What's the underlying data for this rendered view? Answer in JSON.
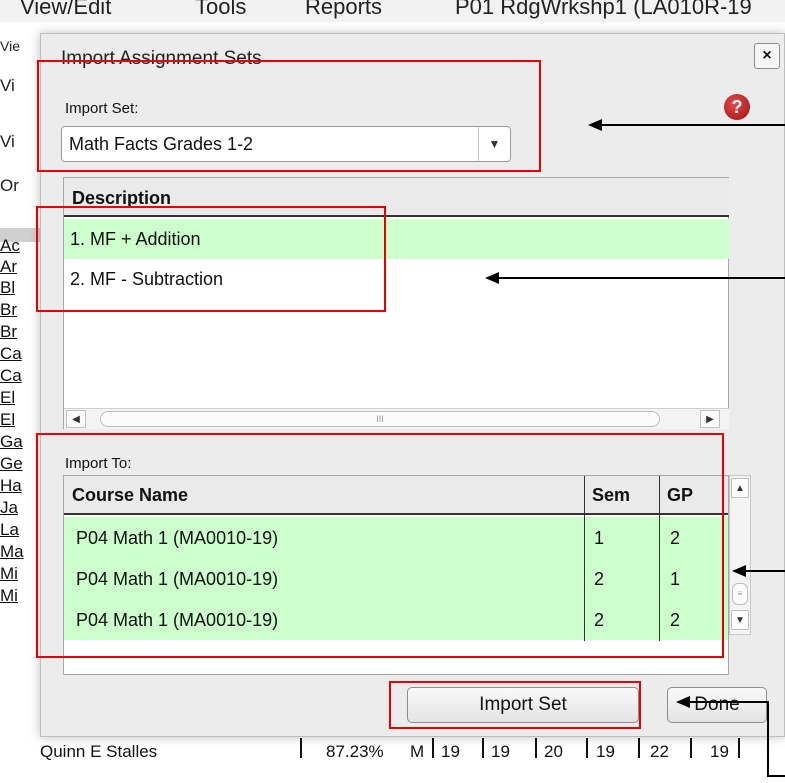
{
  "background": {
    "menu": [
      "View/Edit",
      "Tools",
      "Reports",
      "P01  RdgWrkshp1 (LA010R-19"
    ],
    "side_items": [
      "Vie",
      "Vi",
      "Vi",
      "Or",
      "Ac",
      "Ar",
      "Bl",
      "Br",
      "Br",
      "Ca",
      "Ca",
      "El",
      "El",
      "Ga",
      "Ge",
      "Ha",
      "Ja",
      "La",
      "Ma",
      "Mi",
      "Mi"
    ],
    "bottom_row": {
      "name": "Quinn E Stalles",
      "percent": "87.23%",
      "mark": "M",
      "scores": [
        "19",
        "19",
        "20",
        "19",
        "22",
        "19"
      ]
    }
  },
  "dialog": {
    "title": "Import Assignment Sets",
    "close_label": "×",
    "help_label": "?",
    "import_set": {
      "label": "Import Set:",
      "selected": "Math Facts Grades 1-2",
      "arrow": "▼"
    },
    "description": {
      "header": "Description",
      "rows": [
        "1. MF + Addition",
        "2. MF - Subtraction"
      ],
      "scroll_left": "◀",
      "scroll_right": "▶",
      "thumb_grip": "III"
    },
    "import_to": {
      "label": "Import To:",
      "columns": [
        "Course Name",
        "Sem",
        "GP"
      ],
      "rows": [
        {
          "course": "P04  Math 1 (MA0010-19)",
          "sem": "1",
          "gp": "2"
        },
        {
          "course": "P04  Math 1 (MA0010-19)",
          "sem": "2",
          "gp": "1"
        },
        {
          "course": "P04  Math 1 (MA0010-19)",
          "sem": "2",
          "gp": "2"
        }
      ],
      "scroll_up": "▲",
      "scroll_down": "▼",
      "thumb_grip": "≡"
    },
    "buttons": {
      "import_set": "Import Set",
      "done": "Done"
    }
  },
  "colors": {
    "selected_row": "#ccffcc",
    "annotation_red": "#e60000",
    "help_icon": "#c01a1a"
  }
}
